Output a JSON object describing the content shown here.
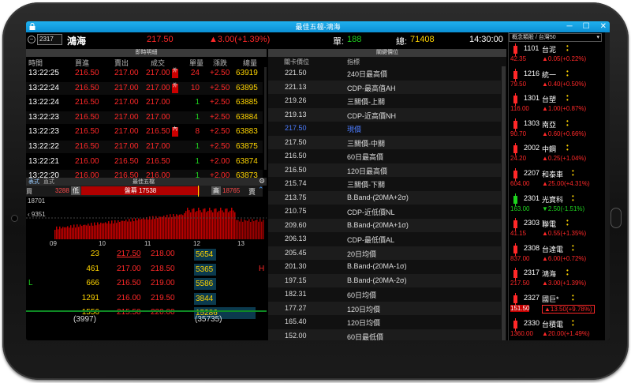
{
  "window": {
    "title": "最佳五檔-鴻海",
    "controls": [
      "─",
      "☐",
      "✕"
    ]
  },
  "quote": {
    "code": "2317",
    "name": "鴻海",
    "price": "217.50",
    "change": "▲3.00(+1.39%)",
    "volume_label": "單:",
    "volume": "188",
    "total_label": "總:",
    "total": "71408",
    "time": "14:30:00"
  },
  "ticks": {
    "title": "即時明細",
    "headers": [
      "時間",
      "買進",
      "賣出",
      "成交",
      "單量",
      "漲跌",
      "總量"
    ],
    "rows": [
      {
        "time": "13:22:25",
        "bid": "216.50",
        "ask": "217.00",
        "deal": "217.00",
        "flag": "外",
        "qty": "24",
        "chg": "+2.50",
        "total": "63919",
        "qty_color": "red"
      },
      {
        "time": "13:22:24",
        "bid": "216.50",
        "ask": "217.00",
        "deal": "217.00",
        "flag": "外",
        "qty": "10",
        "chg": "+2.50",
        "total": "63895",
        "qty_color": "red"
      },
      {
        "time": "13:22:24",
        "bid": "216.50",
        "ask": "217.00",
        "deal": "217.00",
        "flag": "",
        "qty": "1",
        "chg": "+2.50",
        "total": "63885",
        "qty_color": "green"
      },
      {
        "time": "13:22:23",
        "bid": "216.50",
        "ask": "217.00",
        "deal": "217.00",
        "flag": "",
        "qty": "1",
        "chg": "+2.50",
        "total": "63884",
        "qty_color": "green"
      },
      {
        "time": "13:22:23",
        "bid": "216.50",
        "ask": "217.00",
        "deal": "216.50",
        "flag": "內",
        "qty": "8",
        "chg": "+2.50",
        "total": "63883",
        "qty_color": "red"
      },
      {
        "time": "13:22:22",
        "bid": "216.50",
        "ask": "217.00",
        "deal": "217.00",
        "flag": "",
        "qty": "1",
        "chg": "+2.50",
        "total": "63875",
        "qty_color": "green"
      },
      {
        "time": "13:22:21",
        "bid": "216.00",
        "ask": "216.50",
        "deal": "216.50",
        "flag": "",
        "qty": "1",
        "chg": "+2.00",
        "total": "63874",
        "qty_color": "green"
      },
      {
        "time": "13:22:20",
        "bid": "216.00",
        "ask": "216.50",
        "deal": "216.00",
        "flag": "",
        "qty": "1",
        "chg": "+2.00",
        "total": "63873",
        "qty_color": "green"
      }
    ]
  },
  "five": {
    "tabs": [
      "表式",
      "直式"
    ],
    "title": "最佳五檔",
    "low_price": "3288",
    "low_label": "低",
    "mid_label": "盤幕 17538",
    "high_label": "高",
    "high_price": "18765",
    "sell_label": "賣",
    "buy_label": "買",
    "chart_top": "18701",
    "chart_mid": "9351",
    "time_ticks": [
      "09",
      "10",
      "11",
      "12",
      "13"
    ],
    "rows": [
      {
        "bidvol": "23",
        "bid": "217.50",
        "ask": "218.00",
        "askvol": "5654",
        "bidvol_color": "yellow",
        "marker": ""
      },
      {
        "bidvol": "461",
        "bid": "217.00",
        "ask": "218.50",
        "askvol": "5365",
        "bidvol_color": "yellow",
        "marker": "H"
      },
      {
        "bidvol": "666",
        "bid": "216.50",
        "ask": "219.00",
        "askvol": "5586",
        "bidvol_color": "yellow",
        "marker": "L"
      },
      {
        "bidvol": "1291",
        "bid": "216.00",
        "ask": "219.50",
        "askvol": "3844",
        "bidvol_color": "yellow",
        "marker": ""
      },
      {
        "bidvol": "1556",
        "bid": "215.50",
        "ask": "220.00",
        "askvol": "15286",
        "bidvol_color": "yellow",
        "marker": ""
      }
    ],
    "bid_total": "(3997)",
    "ask_total": "(35735)"
  },
  "levels": {
    "title": "關鍵價位",
    "headers": [
      "關卡價位",
      "指標"
    ],
    "rows": [
      {
        "price": "221.50",
        "label": "240日最高價"
      },
      {
        "price": "221.13",
        "label": "CDP-最高值AH"
      },
      {
        "price": "219.26",
        "label": "三關價-上關"
      },
      {
        "price": "219.13",
        "label": "CDP-近高價NH"
      },
      {
        "price": "217.50",
        "label": "現價",
        "current": true
      },
      {
        "price": "217.50",
        "label": "三關價-中關"
      },
      {
        "price": "216.50",
        "label": "60日最高價"
      },
      {
        "price": "216.50",
        "label": "120日最高價"
      },
      {
        "price": "215.74",
        "label": "三關價-下關"
      },
      {
        "price": "213.75",
        "label": "B.Band-(20MA+2σ)"
      },
      {
        "price": "210.75",
        "label": "CDP-近低價NL"
      },
      {
        "price": "209.60",
        "label": "B.Band-(20MA+1σ)"
      },
      {
        "price": "206.13",
        "label": "CDP-最低價AL"
      },
      {
        "price": "205.45",
        "label": "20日均價"
      },
      {
        "price": "201.30",
        "label": "B.Band-(20MA-1σ)"
      },
      {
        "price": "197.15",
        "label": "B.Band-(20MA-2σ)"
      },
      {
        "price": "182.31",
        "label": "60日均價"
      },
      {
        "price": "177.27",
        "label": "120日均價"
      },
      {
        "price": "165.40",
        "label": "120日均價"
      },
      {
        "price": "152.00",
        "label": "60日最低價"
      }
    ]
  },
  "sidebar": {
    "title": "概念類股 / 台灣50",
    "items": [
      {
        "code": "1101",
        "name": "台泥",
        "price": "42.35",
        "chg": "▲0.05(+0.22%)",
        "color": "red"
      },
      {
        "code": "1216",
        "name": "統一",
        "price": "79.50",
        "chg": "▲0.40(+0.50%)",
        "color": "red"
      },
      {
        "code": "1301",
        "name": "台塑",
        "price": "116.00",
        "chg": "▲1.00(+0.87%)",
        "color": "red"
      },
      {
        "code": "1303",
        "name": "南亞",
        "price": "90.70",
        "chg": "▲0.60(+0.66%)",
        "color": "red"
      },
      {
        "code": "2002",
        "name": "中鋼",
        "price": "24.20",
        "chg": "▲0.25(+1.04%)",
        "color": "red"
      },
      {
        "code": "2207",
        "name": "和泰車",
        "price": "604.00",
        "chg": "▲25.00(+4.31%)",
        "color": "red"
      },
      {
        "code": "2301",
        "name": "光寶科",
        "price": "163.00",
        "chg": "▼2.50(-1.51%)",
        "color": "green"
      },
      {
        "code": "2303",
        "name": "聯電",
        "price": "41.15",
        "chg": "▲0.55(+1.35%)",
        "color": "red"
      },
      {
        "code": "2308",
        "name": "台達電",
        "price": "837.00",
        "chg": "▲6.00(+0.72%)",
        "color": "red"
      },
      {
        "code": "2317",
        "name": "鴻海",
        "price": "217.50",
        "chg": "▲3.00(+1.39%)",
        "color": "red"
      },
      {
        "code": "2327",
        "name": "國巨*",
        "price": "151.50",
        "chg": "▲13.50(+9.78%)",
        "color": "red",
        "limit": true
      },
      {
        "code": "2330",
        "name": "台積電",
        "price": "1360.00",
        "chg": "▲20.00(+1.49%)",
        "color": "red"
      }
    ]
  }
}
